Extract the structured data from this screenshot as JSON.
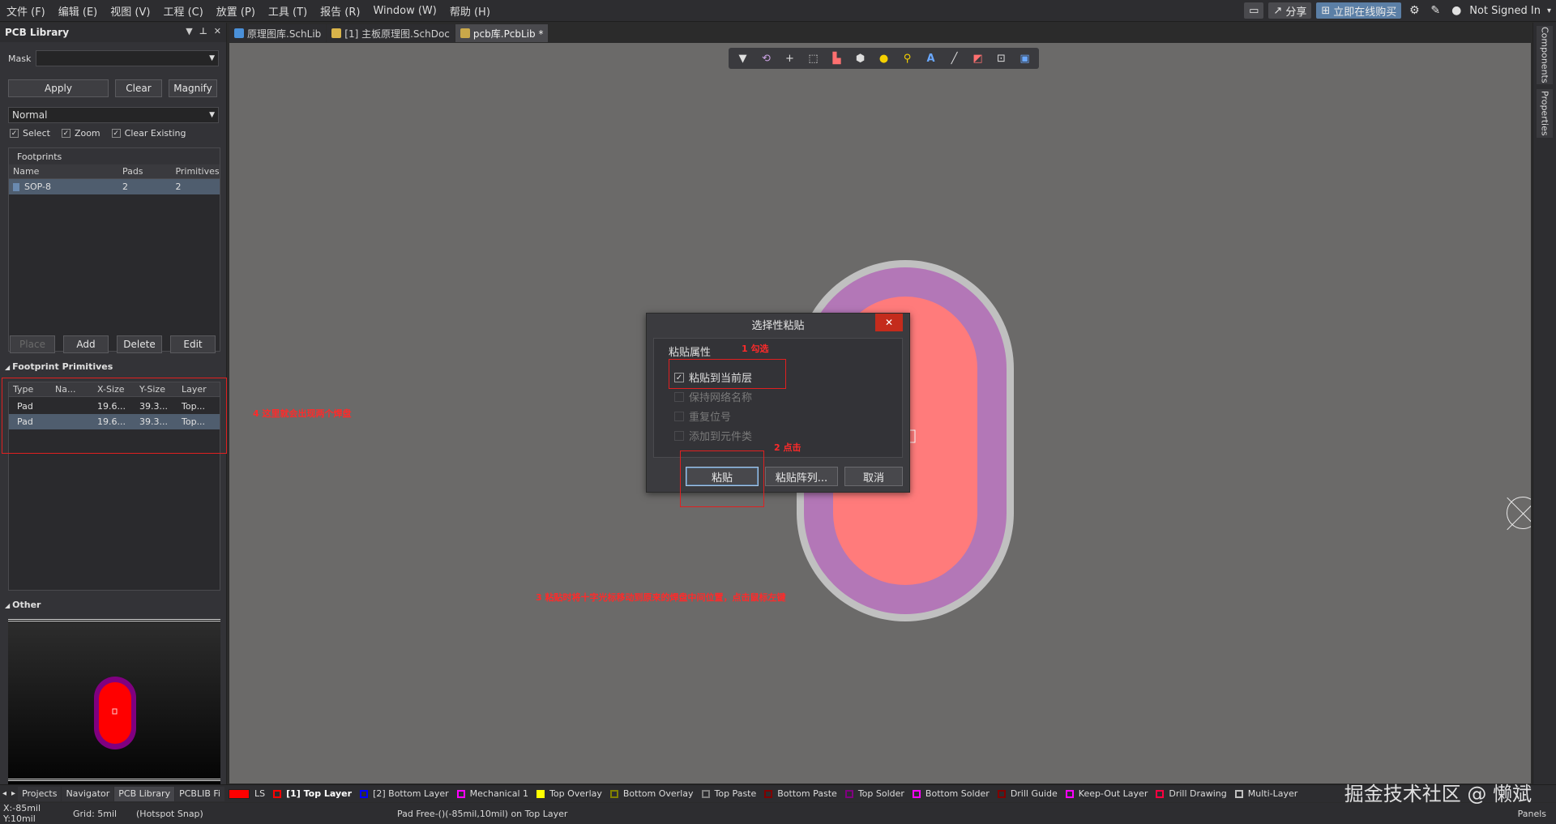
{
  "menu": [
    "文件 (F)",
    "编辑 (E)",
    "视图 (V)",
    "工程 (C)",
    "放置 (P)",
    "工具 (T)",
    "报告 (R)",
    "Window (W)",
    "帮助 (H)"
  ],
  "topright": {
    "share": "分享",
    "buy": "立即在线购买",
    "user": "Not Signed In"
  },
  "panel": {
    "title": "PCB Library",
    "mask_label": "Mask",
    "mask_value": "",
    "apply": "Apply",
    "clear": "Clear",
    "magnify": "Magnify",
    "mode": "Normal",
    "check_select": "Select",
    "check_zoom": "Zoom",
    "check_clear": "Clear Existing",
    "footprints_label": "Footprints",
    "fp_cols": [
      "Name",
      "Pads",
      "Primitives"
    ],
    "fp_rows": [
      {
        "name": "SOP-8",
        "pads": "2",
        "prims": "2"
      }
    ],
    "place": "Place",
    "add": "Add",
    "delete": "Delete",
    "edit": "Edit",
    "primitives_label": "Footprint Primitives",
    "prim_cols": [
      "Type",
      "Na...",
      "X-Size",
      "Y-Size",
      "Layer"
    ],
    "prim_rows": [
      {
        "type": "Pad",
        "name": "",
        "x": "19.6...",
        "y": "39.3...",
        "layer": "Top..."
      },
      {
        "type": "Pad",
        "name": "",
        "x": "19.6...",
        "y": "39.3...",
        "layer": "Top..."
      }
    ],
    "other_label": "Other"
  },
  "tabs": [
    "原理图库.SchLib",
    "[1] 主板原理图.SchDoc",
    "pcb库.PcbLib *"
  ],
  "rail": [
    "Components",
    "Properties"
  ],
  "dialog": {
    "title": "选择性粘贴",
    "group_label": "粘贴属性",
    "opt1": "粘贴到当前层",
    "opt2": "保持网络名称",
    "opt3": "重复位号",
    "opt4": "添加到元件类",
    "paste": "粘贴",
    "paste_array": "粘贴阵列...",
    "cancel": "取消"
  },
  "annotations": {
    "a1": "1 勾选",
    "a2": "2 点击",
    "a3": "3 粘贴时将十字光标移动到原来的焊盘中间位置，点击鼠标左键",
    "a4": "4 这里就会出现两个焊盘"
  },
  "nav_tabs": [
    "Projects",
    "Navigator",
    "PCB Library",
    "PCBLIB Fi"
  ],
  "layers": [
    {
      "name": "LS",
      "color": "#ff0000"
    },
    {
      "name": "[1] Top Layer",
      "color": "#ff0000"
    },
    {
      "name": "[2] Bottom Layer",
      "color": "#0000ff"
    },
    {
      "name": "Mechanical 1",
      "color": "#ff00ff"
    },
    {
      "name": "Top Overlay",
      "color": "#ffff00"
    },
    {
      "name": "Bottom Overlay",
      "color": "#808000"
    },
    {
      "name": "Top Paste",
      "color": "#808080"
    },
    {
      "name": "Bottom Paste",
      "color": "#800000"
    },
    {
      "name": "Top Solder",
      "color": "#800080"
    },
    {
      "name": "Bottom Solder",
      "color": "#ff00ff"
    },
    {
      "name": "Drill Guide",
      "color": "#800000"
    },
    {
      "name": "Keep-Out Layer",
      "color": "#ff00ff"
    },
    {
      "name": "Drill Drawing",
      "color": "#ff0040"
    },
    {
      "name": "Multi-Layer",
      "color": "#c0c0c0"
    }
  ],
  "status": {
    "coords": "X:-85mil Y:10mil",
    "grid": "Grid: 5mil",
    "snap": "(Hotspot Snap)",
    "object": "Pad Free-()(-85mil,10mil) on Top Layer",
    "panels": "Panels"
  },
  "watermark": "掘金技术社区 @ 懒斌"
}
